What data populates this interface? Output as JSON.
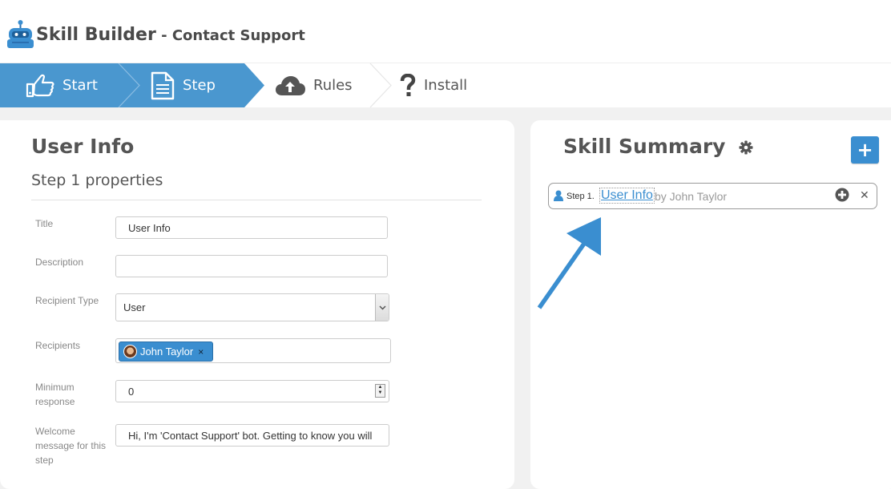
{
  "app": {
    "title": "Skill Builder",
    "separator": " - ",
    "subtitle": "Contact Support",
    "logo_icon": "robot-icon"
  },
  "wizard": {
    "steps": [
      {
        "label": "Start",
        "icon": "thumbs-up-icon",
        "state": "completed"
      },
      {
        "label": "Step",
        "icon": "document-icon",
        "state": "active"
      },
      {
        "label": "Rules",
        "icon": "cloud-upload-icon",
        "state": "inactive"
      },
      {
        "label": "Install",
        "icon": "question-icon",
        "state": "inactive"
      }
    ],
    "active_color": "#4a97cf"
  },
  "form": {
    "title": "User Info",
    "subtitle": "Step 1 properties",
    "fields": {
      "title": {
        "label": "Title",
        "value": "User Info"
      },
      "description": {
        "label": "Description",
        "value": ""
      },
      "recipient_type": {
        "label": "Recipient Type",
        "value": "User"
      },
      "recipients": {
        "label": "Recipients",
        "tokens": [
          "John Taylor"
        ]
      },
      "minimum_response": {
        "label": "Minimum response",
        "value": "0"
      },
      "welcome": {
        "label": "Welcome message for this step",
        "value": "Hi, I'm 'Contact Support' bot. Getting to know you will"
      }
    }
  },
  "summary": {
    "title": "Skill Summary",
    "settings_icon": "gear-icon",
    "add_label": "+",
    "items": [
      {
        "prefix": "Step 1.",
        "link": "User Info",
        "by": "by John Taylor",
        "icon": "user-icon"
      }
    ]
  },
  "colors": {
    "accent": "#3a8ed0",
    "text": "#555555",
    "background": "#f1f1f1"
  }
}
